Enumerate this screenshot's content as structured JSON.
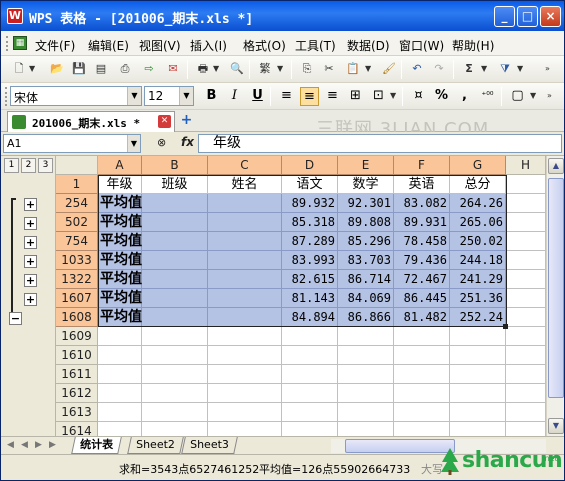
{
  "window": {
    "title": "WPS 表格 - [201006_期末.xls *]",
    "app_icon": "W",
    "buttons": [
      "_",
      "□",
      "×"
    ]
  },
  "menu": [
    "文件(F)",
    "编辑(E)",
    "视图(V)",
    "插入(I)",
    "格式(O)",
    "工具(T)",
    "数据(D)",
    "窗口(W)",
    "帮助(H)"
  ],
  "font_toolbar": {
    "font_name": "宋体",
    "font_size": "12",
    "bold": "B",
    "italic": "I",
    "underline": "U",
    "percent": "%",
    "comma": ","
  },
  "doc_tab": {
    "name": "201006_期末.xls *",
    "new_tab": "+"
  },
  "watermark": "三联网 3LIAN.COM",
  "formula_bar": {
    "name_box": "A1",
    "fx": "fx",
    "content": "年级"
  },
  "outline": {
    "levels": [
      "1",
      "2",
      "3"
    ],
    "row_buttons": [
      "+",
      "+",
      "+",
      "+",
      "+",
      "+",
      "−"
    ]
  },
  "columns": [
    "A",
    "B",
    "C",
    "D",
    "E",
    "F",
    "G",
    "H"
  ],
  "rows": [
    {
      "num": "1",
      "cells": [
        "年级",
        "班级",
        "姓名",
        "语文",
        "数学",
        "英语",
        "总分"
      ]
    },
    {
      "num": "254",
      "cells": [
        "平均值",
        "",
        "",
        "89.932",
        "92.301",
        "83.082",
        "264.26"
      ]
    },
    {
      "num": "502",
      "cells": [
        "平均值",
        "",
        "",
        "85.318",
        "89.808",
        "89.931",
        "265.06"
      ]
    },
    {
      "num": "754",
      "cells": [
        "平均值",
        "",
        "",
        "87.289",
        "85.296",
        "78.458",
        "250.02"
      ]
    },
    {
      "num": "1033",
      "cells": [
        "平均值",
        "",
        "",
        "83.993",
        "83.703",
        "79.436",
        "244.18"
      ]
    },
    {
      "num": "1322",
      "cells": [
        "平均值",
        "",
        "",
        "82.615",
        "86.714",
        "72.467",
        "241.29"
      ]
    },
    {
      "num": "1607",
      "cells": [
        "平均值",
        "",
        "",
        "81.143",
        "84.069",
        "86.445",
        "251.36"
      ]
    },
    {
      "num": "1608",
      "cells": [
        "平均值",
        "",
        "",
        "84.894",
        "86.866",
        "81.482",
        "252.24"
      ]
    },
    {
      "num": "1609",
      "cells": [
        "",
        "",
        "",
        "",
        "",
        "",
        ""
      ]
    },
    {
      "num": "1610",
      "cells": [
        "",
        "",
        "",
        "",
        "",
        "",
        ""
      ]
    },
    {
      "num": "1611",
      "cells": [
        "",
        "",
        "",
        "",
        "",
        "",
        ""
      ]
    },
    {
      "num": "1612",
      "cells": [
        "",
        "",
        "",
        "",
        "",
        "",
        ""
      ]
    },
    {
      "num": "1613",
      "cells": [
        "",
        "",
        "",
        "",
        "",
        "",
        ""
      ]
    },
    {
      "num": "1614",
      "cells": [
        "",
        "",
        "",
        "",
        "",
        "",
        ""
      ]
    }
  ],
  "sheet_tabs": [
    "统计表",
    "Sheet2",
    "Sheet3"
  ],
  "status": {
    "sum": "求和=3543点6527461252",
    "average": "平均值=126点55902664733",
    "mode": "大写"
  },
  "logo": {
    "text": "shancun",
    "sub": ".net"
  }
}
